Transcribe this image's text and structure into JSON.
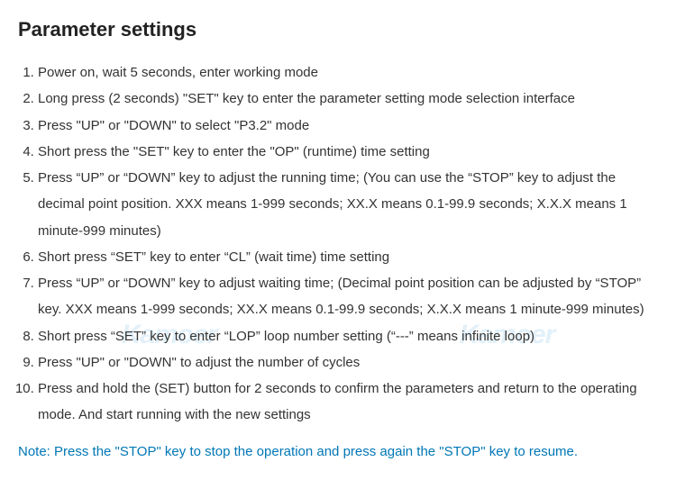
{
  "title": "Parameter settings",
  "steps": [
    "Power on, wait 5 seconds, enter working mode",
    "Long press (2 seconds) \"SET\" key to enter the parameter setting mode selection interface",
    "Press \"UP\" or \"DOWN\" to select \"P3.2\" mode",
    "Short press the \"SET\" key to enter the \"OP\" (runtime) time setting",
    "Press “UP” or “DOWN” key to adjust the running time; (You can use the “STOP” key to adjust the decimal point position. XXX means 1-999 seconds; XX.X means 0.1-99.9 seconds; X.X.X means 1 minute-999 minutes)",
    "Short press “SET” key to enter “CL” (wait time) time setting",
    "Press “UP” or “DOWN” key to adjust waiting time; (Decimal point position can be adjusted by “STOP” key. XXX means 1-999 seconds; XX.X means 0.1-99.9 seconds; X.X.X means 1 minute-999 minutes)",
    "Short press “SET” key to enter “LOP” loop number setting (“---” means infinite loop)",
    "Press \"UP\" or \"DOWN\" to adjust the number of cycles",
    "Press and hold the (SET) button for 2 seconds to confirm the parameters and return to the operating mode. And start running with the new settings"
  ],
  "note": "Note: Press the \"STOP\" key to stop the operation and press again the \"STOP\" key to resume.",
  "watermark": "Kamoer"
}
